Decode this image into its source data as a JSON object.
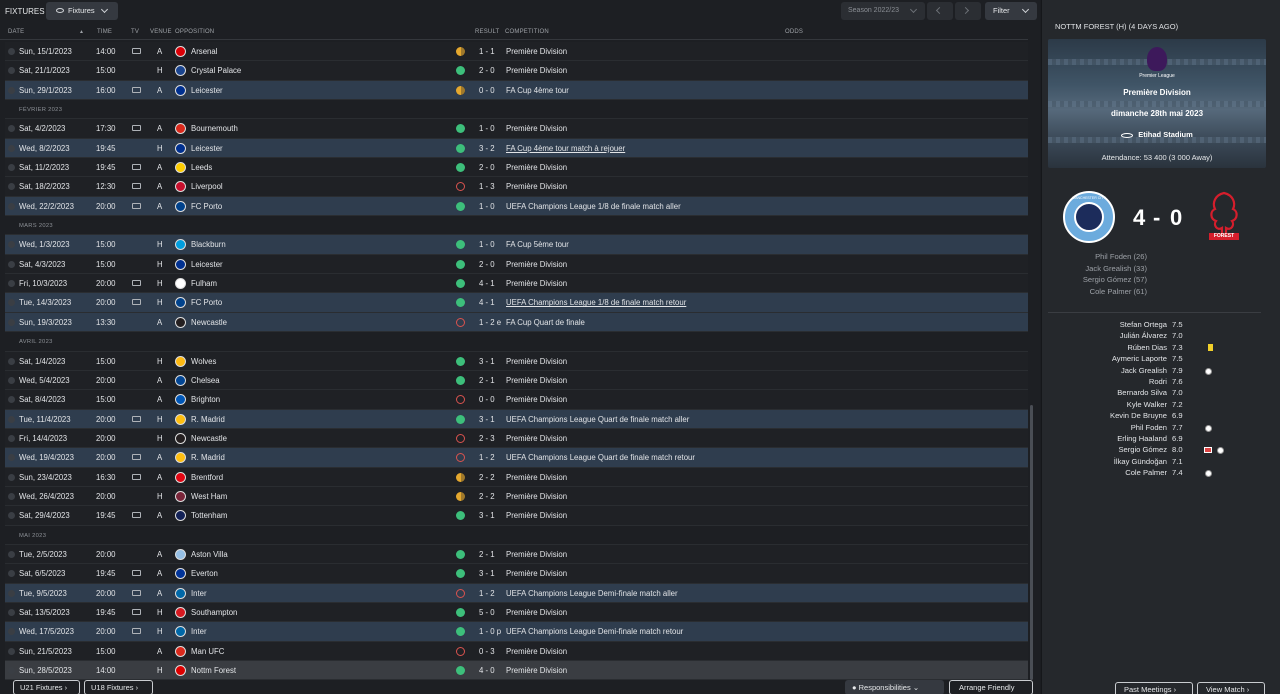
{
  "header": {
    "title": "FIXTURES",
    "view_label": "Fixtures",
    "season": "Season 2022/23",
    "filter": "Filter"
  },
  "columns": {
    "date": "DATE",
    "time": "TIME",
    "tv": "TV",
    "venue": "VENUE",
    "opposition": "OPPOSITION",
    "result": "RESULT",
    "competition": "COMPETITION",
    "odds": "ODDS"
  },
  "colors": {
    "win": "#3dbf7b",
    "draw": "#e5a82e",
    "loss": "#d9534f",
    "highlight": "#2f3d4e"
  },
  "rows": [
    {
      "kind": "match",
      "date": "Sun, 15/1/2023",
      "time": "14:00",
      "tv": true,
      "venue": "A",
      "opp": "Arsenal",
      "res": "d",
      "score": "1 - 1",
      "comp": "Première Division",
      "hl": false,
      "crest": "#db0007"
    },
    {
      "kind": "match",
      "date": "Sat, 21/1/2023",
      "time": "15:00",
      "tv": false,
      "venue": "H",
      "opp": "Crystal Palace",
      "res": "w",
      "score": "2 - 0",
      "comp": "Première Division",
      "hl": false,
      "crest": "#1b458f"
    },
    {
      "kind": "match",
      "date": "Sun, 29/1/2023",
      "time": "16:00",
      "tv": true,
      "venue": "A",
      "opp": "Leicester",
      "res": "d",
      "score": "0 - 0",
      "comp": "FA Cup 4ème tour",
      "hl": true,
      "crest": "#003090"
    },
    {
      "kind": "month",
      "label": "FÉVRIER 2023"
    },
    {
      "kind": "match",
      "date": "Sat, 4/2/2023",
      "time": "17:30",
      "tv": true,
      "venue": "A",
      "opp": "Bournemouth",
      "res": "w",
      "score": "1 - 0",
      "comp": "Première Division",
      "hl": false,
      "crest": "#da291c"
    },
    {
      "kind": "match",
      "date": "Wed, 8/2/2023",
      "time": "19:45",
      "tv": false,
      "venue": "H",
      "opp": "Leicester",
      "res": "w",
      "score": "3 - 2",
      "comp": "FA Cup 4ème tour match à rejouer",
      "hl": true,
      "u": true,
      "crest": "#003090"
    },
    {
      "kind": "match",
      "date": "Sat, 11/2/2023",
      "time": "19:45",
      "tv": true,
      "venue": "A",
      "opp": "Leeds",
      "res": "w",
      "score": "2 - 0",
      "comp": "Première Division",
      "hl": false,
      "crest": "#ffcd00"
    },
    {
      "kind": "match",
      "date": "Sat, 18/2/2023",
      "time": "12:30",
      "tv": true,
      "venue": "A",
      "opp": "Liverpool",
      "res": "l",
      "score": "1 - 3",
      "comp": "Première Division",
      "hl": false,
      "crest": "#c8102e"
    },
    {
      "kind": "match",
      "date": "Wed, 22/2/2023",
      "time": "20:00",
      "tv": true,
      "venue": "A",
      "opp": "FC Porto",
      "res": "w",
      "score": "1 - 0",
      "comp": "UEFA Champions League 1/8 de finale match aller",
      "hl": true,
      "crest": "#00428c"
    },
    {
      "kind": "month",
      "label": "MARS 2023"
    },
    {
      "kind": "match",
      "date": "Wed, 1/3/2023",
      "time": "15:00",
      "tv": false,
      "venue": "H",
      "opp": "Blackburn",
      "res": "w",
      "score": "1 - 0",
      "comp": "FA Cup 5ème tour",
      "hl": true,
      "crest": "#009ee0"
    },
    {
      "kind": "match",
      "date": "Sat, 4/3/2023",
      "time": "15:00",
      "tv": false,
      "venue": "H",
      "opp": "Leicester",
      "res": "w",
      "score": "2 - 0",
      "comp": "Première Division",
      "hl": false,
      "crest": "#003090"
    },
    {
      "kind": "match",
      "date": "Fri, 10/3/2023",
      "time": "20:00",
      "tv": true,
      "venue": "H",
      "opp": "Fulham",
      "res": "w",
      "score": "4 - 1",
      "comp": "Première Division",
      "hl": false,
      "crest": "#ffffff"
    },
    {
      "kind": "match",
      "date": "Tue, 14/3/2023",
      "time": "20:00",
      "tv": true,
      "venue": "H",
      "opp": "FC Porto",
      "res": "w",
      "score": "4 - 1",
      "comp": "UEFA Champions League 1/8 de finale match retour",
      "hl": true,
      "u": true,
      "crest": "#00428c"
    },
    {
      "kind": "match",
      "date": "Sun, 19/3/2023",
      "time": "13:30",
      "tv": false,
      "venue": "A",
      "opp": "Newcastle",
      "res": "l",
      "score": "1 - 2 e",
      "comp": "FA Cup Quart de finale",
      "hl": true,
      "crest": "#241f20"
    },
    {
      "kind": "month",
      "label": "AVRIL 2023"
    },
    {
      "kind": "match",
      "date": "Sat, 1/4/2023",
      "time": "15:00",
      "tv": false,
      "venue": "H",
      "opp": "Wolves",
      "res": "w",
      "score": "3 - 1",
      "comp": "Première Division",
      "hl": false,
      "crest": "#fdb913"
    },
    {
      "kind": "match",
      "date": "Wed, 5/4/2023",
      "time": "20:00",
      "tv": false,
      "venue": "A",
      "opp": "Chelsea",
      "res": "w",
      "score": "2 - 1",
      "comp": "Première Division",
      "hl": false,
      "crest": "#034694"
    },
    {
      "kind": "match",
      "date": "Sat, 8/4/2023",
      "time": "15:00",
      "tv": false,
      "venue": "A",
      "opp": "Brighton",
      "res": "l",
      "score": "0 - 0",
      "comp": "Première Division",
      "hl": false,
      "crest": "#0057b8"
    },
    {
      "kind": "match",
      "date": "Tue, 11/4/2023",
      "time": "20:00",
      "tv": true,
      "venue": "H",
      "opp": "R. Madrid",
      "res": "w",
      "score": "3 - 1",
      "comp": "UEFA Champions League Quart de finale match aller",
      "hl": true,
      "crest": "#febe10"
    },
    {
      "kind": "match",
      "date": "Fri, 14/4/2023",
      "time": "20:00",
      "tv": false,
      "venue": "H",
      "opp": "Newcastle",
      "res": "l",
      "score": "2 - 3",
      "comp": "Première Division",
      "hl": false,
      "crest": "#241f20"
    },
    {
      "kind": "match",
      "date": "Wed, 19/4/2023",
      "time": "20:00",
      "tv": true,
      "venue": "A",
      "opp": "R. Madrid",
      "res": "l",
      "score": "1 - 2",
      "comp": "UEFA Champions League Quart de finale match retour",
      "hl": true,
      "crest": "#febe10"
    },
    {
      "kind": "match",
      "date": "Sun, 23/4/2023",
      "time": "16:30",
      "tv": true,
      "venue": "A",
      "opp": "Brentford",
      "res": "d",
      "score": "2 - 2",
      "comp": "Première Division",
      "hl": false,
      "crest": "#e30613"
    },
    {
      "kind": "match",
      "date": "Wed, 26/4/2023",
      "time": "20:00",
      "tv": false,
      "venue": "H",
      "opp": "West Ham",
      "res": "d",
      "score": "2 - 2",
      "comp": "Première Division",
      "hl": false,
      "crest": "#7a263a"
    },
    {
      "kind": "match",
      "date": "Sat, 29/4/2023",
      "time": "19:45",
      "tv": true,
      "venue": "A",
      "opp": "Tottenham",
      "res": "w",
      "score": "3 - 1",
      "comp": "Première Division",
      "hl": false,
      "crest": "#132257"
    },
    {
      "kind": "month",
      "label": "MAI 2023"
    },
    {
      "kind": "match",
      "date": "Tue, 2/5/2023",
      "time": "20:00",
      "tv": false,
      "venue": "A",
      "opp": "Aston Villa",
      "res": "w",
      "score": "2 - 1",
      "comp": "Première Division",
      "hl": false,
      "crest": "#95bfe5"
    },
    {
      "kind": "match",
      "date": "Sat, 6/5/2023",
      "time": "19:45",
      "tv": true,
      "venue": "A",
      "opp": "Everton",
      "res": "w",
      "score": "3 - 1",
      "comp": "Première Division",
      "hl": false,
      "crest": "#003399"
    },
    {
      "kind": "match",
      "date": "Tue, 9/5/2023",
      "time": "20:00",
      "tv": true,
      "venue": "A",
      "opp": "Inter",
      "res": "l",
      "score": "1 - 2",
      "comp": "UEFA Champions League Demi-finale match aller",
      "hl": true,
      "crest": "#0068a8"
    },
    {
      "kind": "match",
      "date": "Sat, 13/5/2023",
      "time": "19:45",
      "tv": true,
      "venue": "H",
      "opp": "Southampton",
      "res": "w",
      "score": "5 - 0",
      "comp": "Première Division",
      "hl": false,
      "crest": "#d71920"
    },
    {
      "kind": "match",
      "date": "Wed, 17/5/2023",
      "time": "20:00",
      "tv": true,
      "venue": "H",
      "opp": "Inter",
      "res": "w",
      "score": "1 - 0 p",
      "comp": "UEFA Champions League Demi-finale match retour",
      "hl": true,
      "crest": "#0068a8"
    },
    {
      "kind": "match",
      "date": "Sun, 21/5/2023",
      "time": "15:00",
      "tv": false,
      "venue": "A",
      "opp": "Man UFC",
      "res": "l",
      "score": "0 - 3",
      "comp": "Première Division",
      "hl": false,
      "crest": "#da291c"
    },
    {
      "kind": "match",
      "date": "Sun, 28/5/2023",
      "time": "14:00",
      "tv": false,
      "venue": "H",
      "opp": "Nottm Forest",
      "res": "w",
      "score": "4 - 0",
      "comp": "Première Division",
      "hl": false,
      "last": true,
      "crest": "#dd0000"
    }
  ],
  "bottom": {
    "u21": "U21 Fixtures",
    "u18": "U18 Fixtures",
    "responsibilities": "Responsibilities",
    "arrange": "Arrange Friendly"
  },
  "side": {
    "heading": "NOTTM FOREST (H) (4 DAYS AGO)",
    "competition": "Première Division",
    "league_logo_text": "Premier League",
    "date": "dimanche 28th mai 2023",
    "stadium": "Etihad Stadium",
    "attendance": "Attendance: 53 400 (3 000 Away)",
    "home_badge_text": "MANCHESTER CITY",
    "away_badge_text": "FOREST",
    "score_home": "4",
    "score_sep": "-",
    "score_away": "0",
    "scorers": [
      "Phil Foden (26)",
      "Jack Grealish (33)",
      "Sergio Gómez (57)",
      "Cole Palmer (61)"
    ],
    "players": [
      {
        "n": "Stefan Ortega",
        "r": "7.5"
      },
      {
        "n": "Julián Álvarez",
        "r": "7.0"
      },
      {
        "n": "Rúben Dias",
        "r": "7.3",
        "yc": true
      },
      {
        "n": "Aymeric Laporte",
        "r": "7.5"
      },
      {
        "n": "Jack Grealish",
        "r": "7.9",
        "goal": true
      },
      {
        "n": "Rodri",
        "r": "7.6"
      },
      {
        "n": "Bernardo Silva",
        "r": "7.0"
      },
      {
        "n": "Kyle Walker",
        "r": "7.2"
      },
      {
        "n": "Kevin De Bruyne",
        "r": "6.9"
      },
      {
        "n": "Phil Foden",
        "r": "7.7",
        "goal": true
      },
      {
        "n": "Erling Haaland",
        "r": "6.9"
      },
      {
        "n": "Sergio Gómez",
        "r": "8.0",
        "goal": true,
        "sub": true
      },
      {
        "n": "İlkay Gündoğan",
        "r": "7.1"
      },
      {
        "n": "Cole Palmer",
        "r": "7.4",
        "goal": true
      }
    ],
    "past": "Past Meetings",
    "view": "View Match"
  }
}
